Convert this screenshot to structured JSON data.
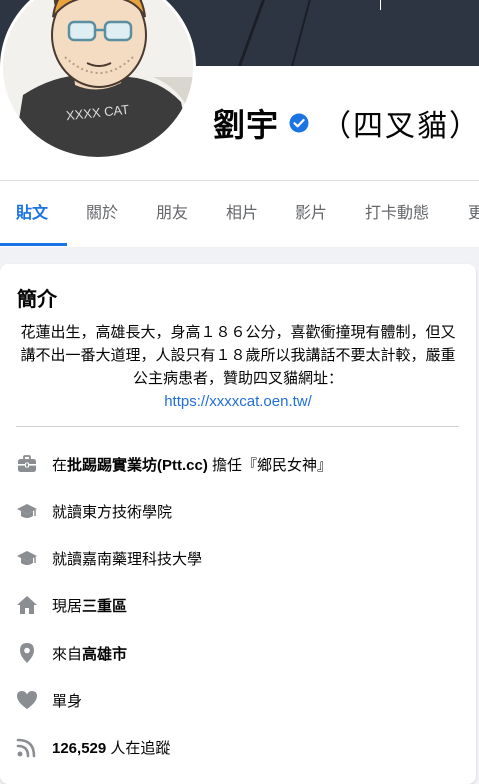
{
  "profile": {
    "name": "劉宇",
    "alias": "（四叉貓）",
    "avatar_shirt_text": "XXXX CAT"
  },
  "tabs": [
    {
      "label": "貼文",
      "active": true
    },
    {
      "label": "關於",
      "active": false
    },
    {
      "label": "朋友",
      "active": false
    },
    {
      "label": "相片",
      "active": false
    },
    {
      "label": "影片",
      "active": false
    },
    {
      "label": "打卡動態",
      "active": false
    },
    {
      "label": "更",
      "active": false
    }
  ],
  "intro": {
    "title": "簡介",
    "bio": "花蓮出生，高雄長大，身高１８６公分，喜歡衝撞現有體制，但又講不出一番大道理，人設只有１８歲所以我講話不要太計較，嚴重公主病患者，贊助四叉貓網址：",
    "link": "https://xxxxcat.oen.tw/",
    "details": [
      {
        "icon": "briefcase-icon",
        "prefix": "在",
        "strong": "批踢踢實業坊(Ptt.cc)",
        "suffix": " 擔任『鄉民女神』"
      },
      {
        "icon": "graduation-cap-icon",
        "prefix": "就讀",
        "strong": "東方技術學院",
        "suffix": ""
      },
      {
        "icon": "graduation-cap-icon",
        "prefix": "就讀",
        "strong": "嘉南藥理科技大學",
        "suffix": ""
      },
      {
        "icon": "home-icon",
        "prefix": "現居",
        "strong": "三重區",
        "suffix": ""
      },
      {
        "icon": "location-pin-icon",
        "prefix": "來自",
        "strong": "高雄市",
        "suffix": ""
      },
      {
        "icon": "heart-icon",
        "prefix": "",
        "strong": "",
        "suffix": "單身"
      },
      {
        "icon": "rss-icon",
        "prefix": "",
        "strong": "126,529",
        "suffix": " 人在追蹤"
      }
    ]
  },
  "colors": {
    "accent": "#1b74e4",
    "link": "#216fdb",
    "icon": "#8a8d91",
    "page_bg": "#f0f2f5"
  }
}
